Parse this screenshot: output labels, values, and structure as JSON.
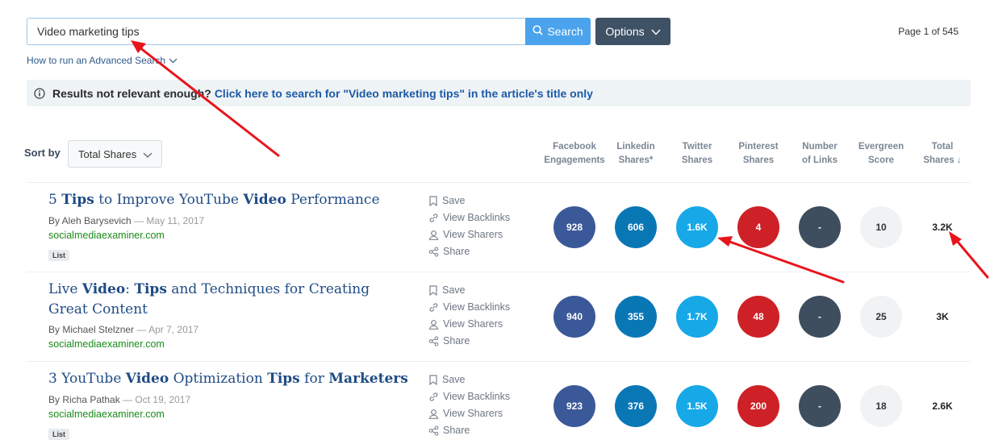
{
  "search": {
    "value": "Video marketing tips",
    "button_label": "Search",
    "options_label": "Options",
    "page_info": "Page 1 of 545"
  },
  "advanced_link": "How to run an Advanced Search",
  "notice": {
    "question": "Results not relevant enough?",
    "link": "Click here to search for \"Video marketing tips\" in the article's title only"
  },
  "sort": {
    "label": "Sort by",
    "selected": "Total Shares"
  },
  "columns": [
    {
      "line1": "Facebook",
      "line2": "Engagements"
    },
    {
      "line1": "Linkedin",
      "line2": "Shares*"
    },
    {
      "line1": "Twitter",
      "line2": "Shares"
    },
    {
      "line1": "Pinterest",
      "line2": "Shares"
    },
    {
      "line1": "Number",
      "line2": "of Links"
    },
    {
      "line1": "Evergreen",
      "line2": "Score"
    },
    {
      "line1": "Total",
      "line2": "Shares ↓"
    }
  ],
  "actions": {
    "save": "Save",
    "backlinks": "View Backlinks",
    "sharers": "View Sharers",
    "share": "Share"
  },
  "results": [
    {
      "title_parts": [
        {
          "text": "5 ",
          "bold": false
        },
        {
          "text": "Tips",
          "bold": true
        },
        {
          "text": " to Improve YouTube ",
          "bold": false
        },
        {
          "text": "Video",
          "bold": true
        },
        {
          "text": " Performance",
          "bold": false
        }
      ],
      "author": "By Aleh Barysevich",
      "date": "May 11, 2017",
      "domain": "socialmediaexaminer.com",
      "tag": "List",
      "facebook": "928",
      "linkedin": "606",
      "twitter": "1.6K",
      "pinterest": "4",
      "links": "-",
      "evergreen": "10",
      "total": "3.2K"
    },
    {
      "title_parts": [
        {
          "text": "Live ",
          "bold": false
        },
        {
          "text": "Video",
          "bold": true
        },
        {
          "text": ": ",
          "bold": false
        },
        {
          "text": "Tips",
          "bold": true
        },
        {
          "text": " and Techniques for Creating Great Content",
          "bold": false
        }
      ],
      "author": "By Michael Stelzner",
      "date": "Apr 7, 2017",
      "domain": "socialmediaexaminer.com",
      "tag": "",
      "facebook": "940",
      "linkedin": "355",
      "twitter": "1.7K",
      "pinterest": "48",
      "links": "-",
      "evergreen": "25",
      "total": "3K"
    },
    {
      "title_parts": [
        {
          "text": "3 YouTube ",
          "bold": false
        },
        {
          "text": "Video",
          "bold": true
        },
        {
          "text": " Optimization ",
          "bold": false
        },
        {
          "text": "Tips",
          "bold": true
        },
        {
          "text": " for ",
          "bold": false
        },
        {
          "text": "Marketers",
          "bold": true
        }
      ],
      "author": "By Richa Pathak",
      "date": "Oct 19, 2017",
      "domain": "socialmediaexaminer.com",
      "tag": "List",
      "facebook": "923",
      "linkedin": "376",
      "twitter": "1.5K",
      "pinterest": "200",
      "links": "-",
      "evergreen": "18",
      "total": "2.6K"
    }
  ],
  "colors": {
    "facebook": "#3b5998",
    "linkedin": "#0a77b5",
    "twitter": "#17a8e8",
    "pinterest": "#cd2127",
    "links": "#3e4e5e",
    "evergreen": "#f0f2f4",
    "annotation_arrow": "#e8141c"
  }
}
